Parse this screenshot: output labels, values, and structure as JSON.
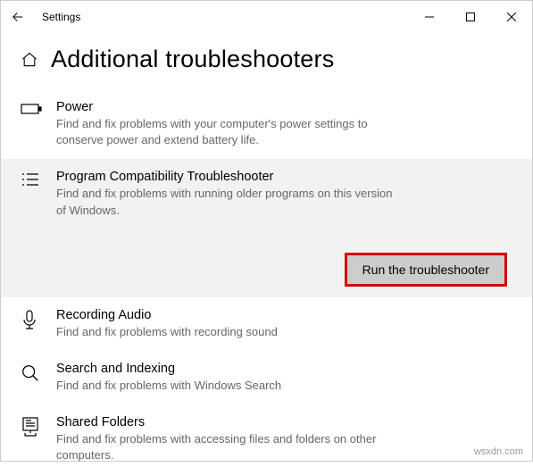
{
  "window": {
    "title": "Settings"
  },
  "page": {
    "heading": "Additional troubleshooters"
  },
  "troubleshooters": {
    "power": {
      "title": "Power",
      "desc": "Find and fix problems with your computer's power settings to conserve power and extend battery life."
    },
    "program_compat": {
      "title": "Program Compatibility Troubleshooter",
      "desc": "Find and fix problems with running older programs on this version of Windows."
    },
    "recording_audio": {
      "title": "Recording Audio",
      "desc": "Find and fix problems with recording sound"
    },
    "search_indexing": {
      "title": "Search and Indexing",
      "desc": "Find and fix problems with Windows Search"
    },
    "shared_folders": {
      "title": "Shared Folders",
      "desc": "Find and fix problems with accessing files and folders on other computers."
    }
  },
  "buttons": {
    "run_troubleshooter": "Run the troubleshooter"
  },
  "watermark": "wsxdn.com"
}
